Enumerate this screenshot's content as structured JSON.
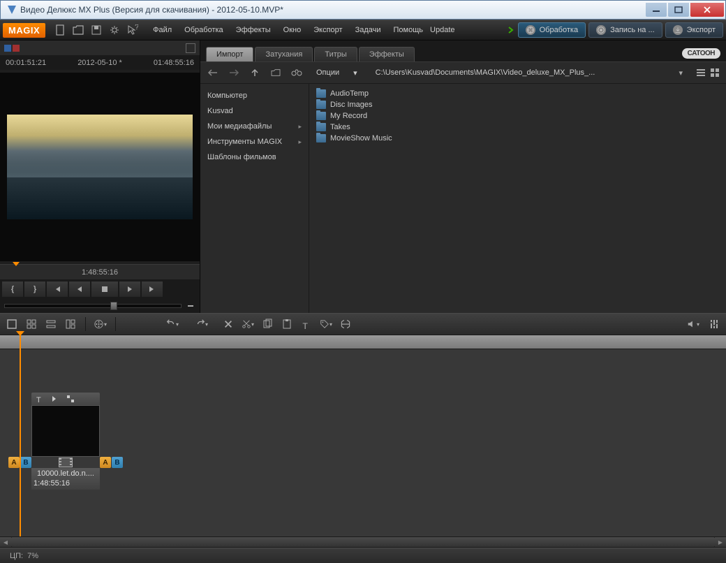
{
  "window": {
    "title": "Видео Делюкс MX Plus (Версия для скачивания) - 2012-05-10.MVP*"
  },
  "brand": "MAGIX",
  "menu": {
    "file": "Файл",
    "edit": "Обработка",
    "effects": "Эффекты",
    "window": "Окно",
    "export": "Экспорт",
    "tasks": "Задачи",
    "help": "Помощь",
    "update": "Update"
  },
  "rightButtons": {
    "edit": "Обработка",
    "burn": "Запись на ...",
    "export": "Экспорт"
  },
  "preview": {
    "tc_left": "00:01:51:21",
    "tc_center": "2012-05-10 *",
    "tc_right": "01:48:55:16",
    "timeline_label": "1:48:55:16"
  },
  "mediaTabs": {
    "import": "Импорт",
    "fades": "Затухания",
    "titles": "Титры",
    "effects": "Эффекты"
  },
  "catoon": "CATOOH",
  "mediaToolbar": {
    "options": "Опции",
    "path": "C:\\Users\\Kusvad\\Documents\\MAGIX\\Video_deluxe_MX_Plus_..."
  },
  "mediaSidebar": {
    "computer": "Компьютер",
    "kusvad": "Kusvad",
    "mymedia": "Мои медиафайлы",
    "magixtools": "Инструменты MAGIX",
    "templates": "Шаблоны фильмов"
  },
  "mediaFiles": [
    "AudioTemp",
    "Disc Images",
    "My Record",
    "Takes",
    "MovieShow Music"
  ],
  "clip": {
    "name": "10000.let.do.n....",
    "duration": "1:48:55:16"
  },
  "status": {
    "cpu_label": "ЦП:",
    "cpu_value": "7%"
  },
  "markers": {
    "a": "A",
    "b": "B"
  },
  "playback": {
    "lbrace": "{",
    "rbrace": "}"
  }
}
